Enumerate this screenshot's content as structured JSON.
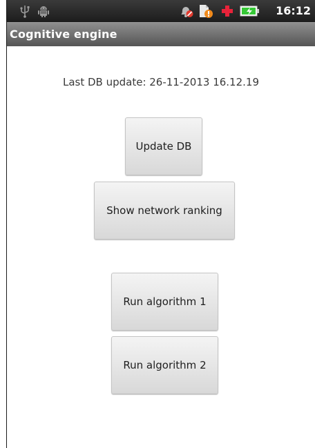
{
  "status_bar": {
    "time": "16:12",
    "icons": [
      "usb-icon",
      "android-debug-icon",
      "alarm-off-icon",
      "download-alert-icon",
      "medical-cross-icon",
      "battery-charging-icon"
    ]
  },
  "app": {
    "title": "Cognitive engine"
  },
  "main": {
    "last_update": "Last DB update: 26-11-2013 16.12.19",
    "buttons": {
      "update_db": "Update DB",
      "show_ranking": "Show network ranking",
      "run_alg1": "Run algorithm 1",
      "run_alg2": "Run algorithm 2"
    }
  },
  "colors": {
    "status_bar": "#1c1c1c",
    "title_bar": "#6e6e6e",
    "button_face": "#e6e6e6",
    "battery_green": "#37c837",
    "cross_red": "#e8233a"
  }
}
